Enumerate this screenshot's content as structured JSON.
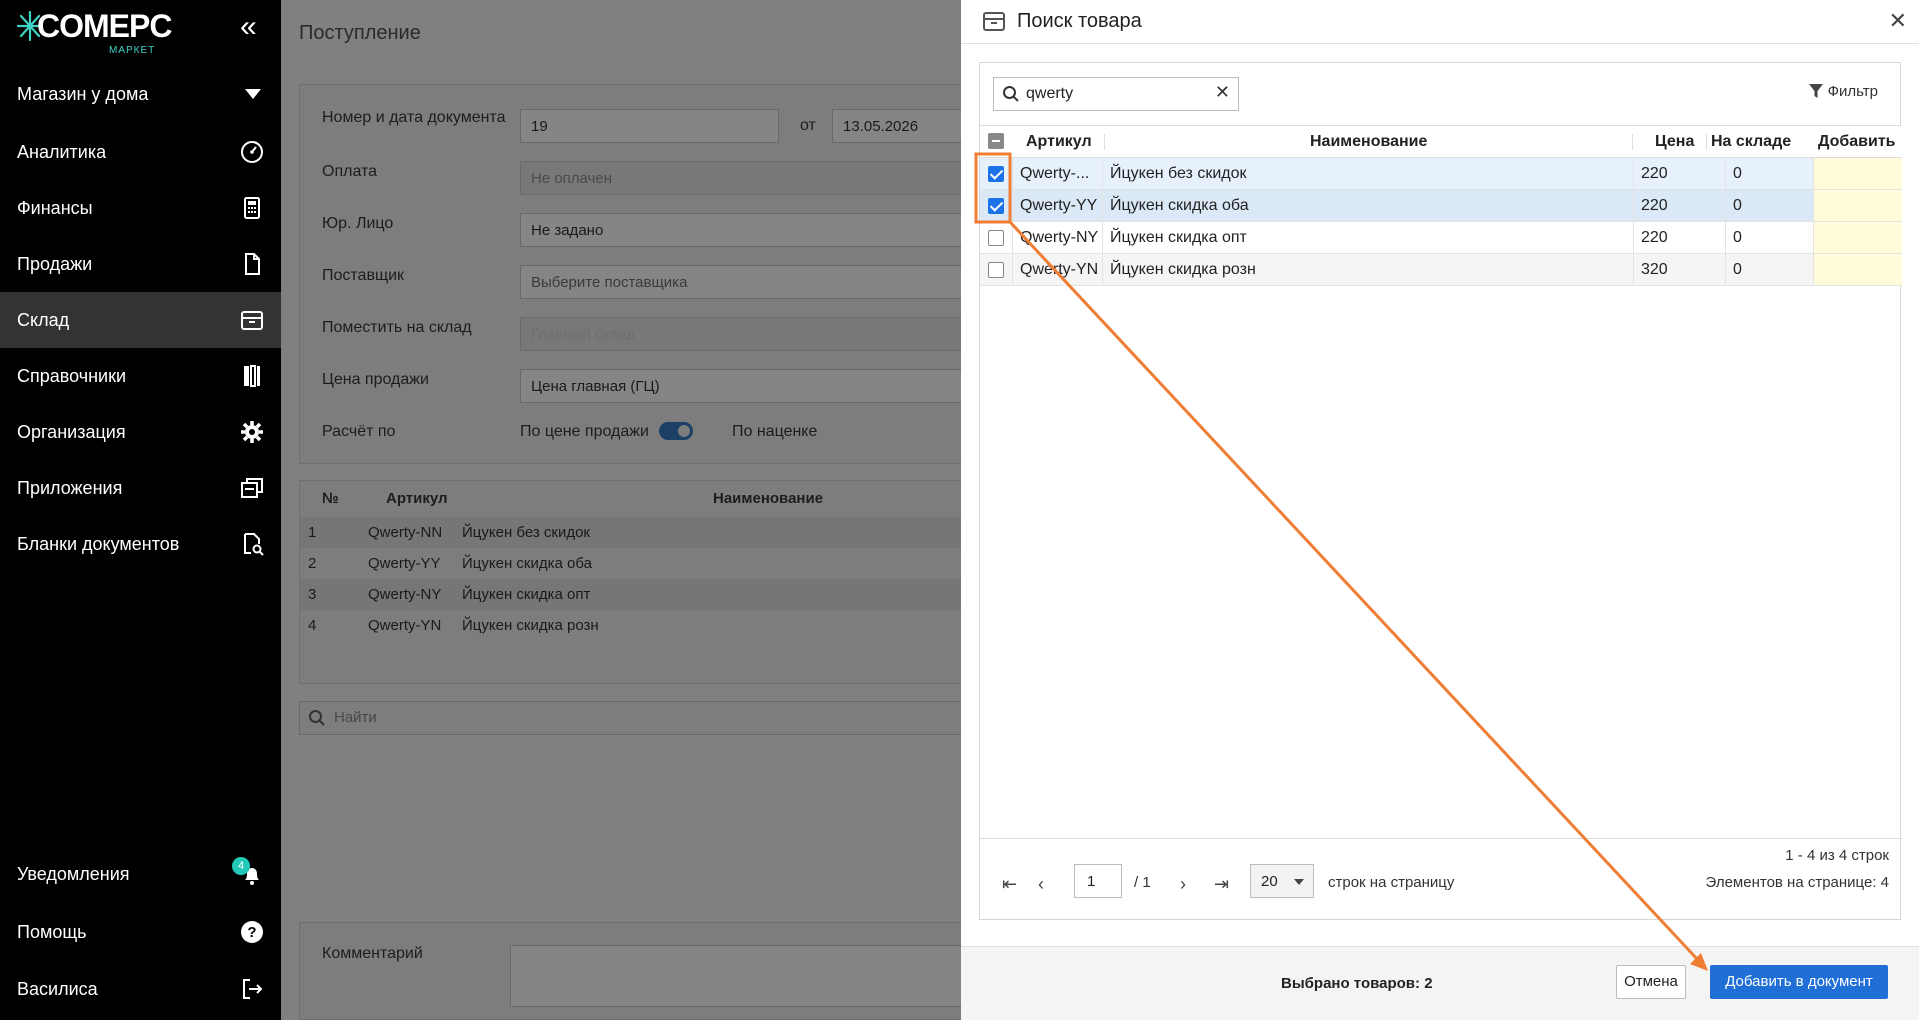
{
  "sidebar": {
    "logo": "COMEPC",
    "logo_sub": "МАРКЕТ",
    "store": "Магазин у дома",
    "items": [
      {
        "label": "Аналитика",
        "icon": "speedometer-icon"
      },
      {
        "label": "Финансы",
        "icon": "calculator-icon"
      },
      {
        "label": "Продажи",
        "icon": "document-icon"
      },
      {
        "label": "Склад",
        "icon": "warehouse-box-icon"
      },
      {
        "label": "Справочники",
        "icon": "books-icon"
      },
      {
        "label": "Организация",
        "icon": "gear-icon"
      },
      {
        "label": "Приложения",
        "icon": "windows-icon"
      },
      {
        "label": "Бланки документов",
        "icon": "document-search-icon"
      }
    ],
    "bottom": [
      {
        "label": "Уведомления",
        "icon": "bell-icon",
        "badge": "4"
      },
      {
        "label": "Помощь",
        "icon": "help-icon"
      },
      {
        "label": "Василиса",
        "icon": "logout-icon"
      }
    ]
  },
  "main": {
    "title": "Поступление",
    "form": {
      "doc_label": "Номер и дата документа",
      "doc_number": "19",
      "from_label": "от",
      "doc_date": "13.05.2026",
      "payment_label": "Оплата",
      "payment_value": "Не оплачен",
      "legal_label": "Юр. Лицо",
      "legal_value": "Не задано",
      "supplier_label": "Поставщик",
      "supplier_placeholder": "Выберите поставщика",
      "warehouse_label": "Поместить на склад",
      "warehouse_value": "Главный склад",
      "price_label": "Цена продажи",
      "price_value": "Цена главная (ГЦ)",
      "calc_label": "Расчёт по",
      "calc_left": "По цене продажи",
      "calc_right": "По наценке"
    },
    "table": {
      "headers": [
        "№",
        "Артикул",
        "Наименование"
      ],
      "rows": [
        [
          "1",
          "Qwerty-NN",
          "Йцукен без скидок"
        ],
        [
          "2",
          "Qwerty-YY",
          "Йцукен скидка оба"
        ],
        [
          "3",
          "Qwerty-NY",
          "Йцукен скидка опт"
        ],
        [
          "4",
          "Qwerty-YN",
          "Йцукен скидка розн"
        ]
      ]
    },
    "search_placeholder": "Найти",
    "comment_label": "Комментарий"
  },
  "modal": {
    "title": "Поиск товара",
    "search_value": "qwerty",
    "filter_label": "Фильтр",
    "headers": {
      "article": "Артикул",
      "name": "Наименование",
      "price": "Цена",
      "stock": "На складе",
      "add": "Добавить"
    },
    "rows": [
      {
        "checked": true,
        "article": "Qwerty-...",
        "name": "Йцукен без скидок",
        "price": "220",
        "stock": "0"
      },
      {
        "checked": true,
        "article": "Qwerty-YY",
        "name": "Йцукен скидка оба",
        "price": "220",
        "stock": "0"
      },
      {
        "checked": false,
        "article": "Qwerty-NY",
        "name": "Йцукен скидка опт",
        "price": "220",
        "stock": "0"
      },
      {
        "checked": false,
        "article": "Qwerty-YN",
        "name": "Йцукен скидка розн",
        "price": "320",
        "stock": "0"
      }
    ],
    "pager": {
      "page": "1",
      "total_pages": "/ 1",
      "per_page": "20",
      "per_page_label": "строк на страницу",
      "range": "1 - 4 из 4 строк",
      "elements": "Элементов на странице: 4"
    },
    "footer": {
      "selected": "Выбрано товаров: 2",
      "cancel": "Отмена",
      "add": "Добавить в документ"
    }
  },
  "colors": {
    "accent": "#1f6fd6",
    "annotation": "#f07d34",
    "sidebar_bg": "#000000",
    "logo_accent": "#3fd3c3"
  }
}
